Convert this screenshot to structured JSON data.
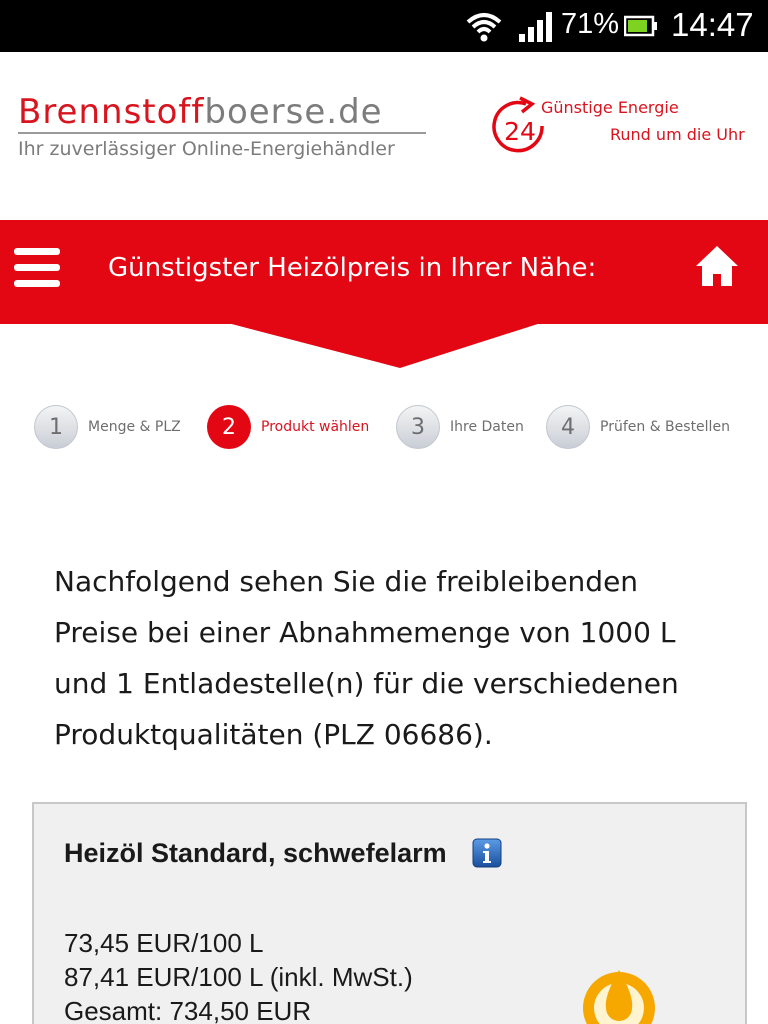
{
  "status_bar": {
    "battery_percent": "71%",
    "time": "14:47"
  },
  "header": {
    "logo_brand": "Brennstoff",
    "logo_domain": "boerse.de",
    "tagline": "Ihr zuverlässiger Online-Energiehändler",
    "badge_number": "24",
    "promo_line1": "Günstige Energie",
    "promo_line2": "Rund um die Uhr"
  },
  "nav": {
    "title": "Günstigster Heizölpreis in Ihrer Nähe:"
  },
  "steps": [
    {
      "number": "1",
      "label": "Menge & PLZ",
      "active": false
    },
    {
      "number": "2",
      "label": "Produkt wählen",
      "active": true
    },
    {
      "number": "3",
      "label": "Ihre Daten",
      "active": false
    },
    {
      "number": "4",
      "label": "Prüfen & Bestellen",
      "active": false
    }
  ],
  "intro": {
    "line1": "Nachfolgend sehen Sie die freibleibenden",
    "line2": "Preise bei einer Abnahmemenge von 1000 L",
    "line3": "und 1 Entladestelle(n) für die verschiedenen",
    "line4": "Produktqualitäten (PLZ 06686)."
  },
  "product": {
    "title": "Heizöl Standard, schwefelarm",
    "price_net": "73,45 EUR/100 L",
    "price_gross": "87,41 EUR/100 L (inkl. MwSt.)",
    "total": "Gesamt: 734,50 EUR"
  },
  "icons": {
    "wifi": "wifi-icon",
    "signal": "signal-icon",
    "battery": "battery-icon",
    "menu": "hamburger-menu-icon",
    "home": "home-icon",
    "info": "info-icon",
    "oil": "oil-drop-icon",
    "badge": "clock-24-icon"
  },
  "colors": {
    "brand_red": "#e30613",
    "text_gray": "#7c7c7c",
    "card_bg": "#f0f0f0",
    "info_blue": "#1e5fae"
  }
}
